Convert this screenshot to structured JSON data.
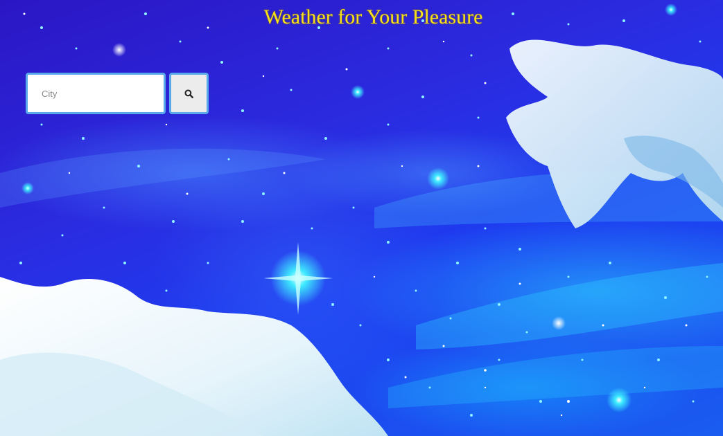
{
  "header": {
    "title": "Weather for Your Pleasure"
  },
  "search": {
    "placeholder": "City",
    "value": "",
    "button_icon": "search-icon"
  },
  "theme": {
    "title_color": "#f7e21a",
    "input_border_color": "#5aa9ea",
    "background_description_colors": [
      "#2b16c4",
      "#1d3df0",
      "#22d8ff",
      "#eef6ff"
    ]
  }
}
